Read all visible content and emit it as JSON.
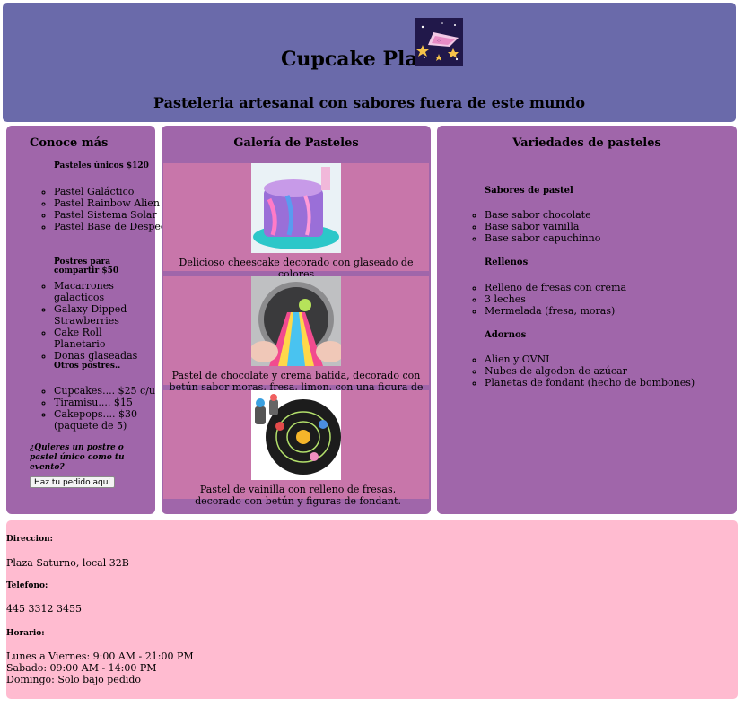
{
  "header": {
    "title": "Cupcake Planet",
    "subtitle": "Pasteleria artesanal con sabores fuera de este mundo"
  },
  "left": {
    "heading": "Conoce más",
    "sections": [
      {
        "title": "Pasteles únicos $120",
        "items": [
          "Pastel Galáctico",
          "Pastel Rainbow Alien",
          "Pastel Sistema Solar",
          "Pastel Base de Despegue"
        ]
      },
      {
        "title": "Postres para compartir $50",
        "items": [
          "Macarrones galacticos",
          "Galaxy Dipped Strawberries",
          "Cake Roll Planetario",
          "Donas glaseadas"
        ]
      },
      {
        "title": "Otros postres..",
        "items": [
          "Cupcakes.... $25 c/u",
          "Tiramisu.... $15",
          "Cakepops.... $30 (paquete de 5)"
        ]
      }
    ],
    "question": "¿Quieres un postre o pastel único como tu evento?",
    "button_label": "Haz tu pedido aqui"
  },
  "gallery": {
    "heading": "Galería de Pasteles",
    "items": [
      {
        "caption": "Delicioso cheescake decorado con glaseado de colores"
      },
      {
        "caption": "Pastel de chocolate y crema batida, decorado con betún sabor moras, fresa, limon, con una figura de alien abduciendo."
      },
      {
        "caption": "Pastel de vainilla con relleno de fresas, decorado con betún y figuras de fondant."
      }
    ]
  },
  "varieties": {
    "heading": "Variedades de pasteles",
    "sections": [
      {
        "title": "Sabores de pastel",
        "items": [
          "Base sabor chocolate",
          "Base sabor vainilla",
          "Base sabor capuchinno"
        ]
      },
      {
        "title": "Rellenos",
        "items": [
          "Relleno de fresas con crema",
          "3 leches",
          "Mermelada (fresa, moras)"
        ]
      },
      {
        "title": "Adornos",
        "items": [
          "Alien y OVNI",
          "Nubes de algodon de azúcar",
          "Planetas de fondant (hecho de bombones)"
        ]
      }
    ]
  },
  "footer": {
    "address_label": "Direccion:",
    "address": "Plaza Saturno, local 32B",
    "phone_label": "Telefono:",
    "phone": "445 3312 3455",
    "hours_label": "Horario:",
    "hours": [
      "Lunes a Viernes: 9:00 AM - 21:00 PM",
      "Sabado: 09:00 AM - 14:00 PM",
      "Domingo: Solo bajo pedido"
    ]
  },
  "colors": {
    "header_bg": "#6a6aaa",
    "column_bg": "#a066aa",
    "gallery_item_bg": "#c876aa",
    "footer_bg": "#ffbbd0"
  }
}
